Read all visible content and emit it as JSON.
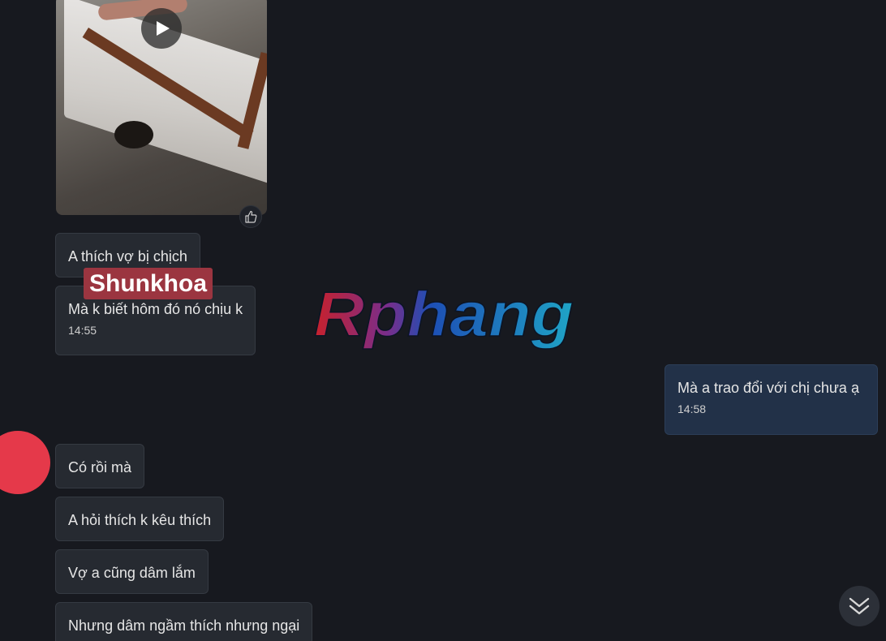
{
  "thread": {
    "video": {
      "icon": "play-icon",
      "reaction_icon": "thumbs-up-icon"
    },
    "messages": [
      {
        "text": "A thích vợ bị chịch",
        "time": ""
      },
      {
        "text": "Mà k biết hôm đó nó chịu k",
        "time": "14:55"
      },
      {
        "text": "Mà a trao đổi với chị chưa ạ",
        "time": "14:58",
        "outgoing": true
      },
      {
        "text": "Có rồi mà",
        "time": ""
      },
      {
        "text": "A hỏi thích k kêu thích",
        "time": ""
      },
      {
        "text": "Vợ a cũng dâm lắm",
        "time": ""
      },
      {
        "text": "Nhưng dâm ngầm thích nhưng ngại",
        "time": ""
      }
    ]
  },
  "overlays": {
    "name_tag": "Shunkhoa",
    "watermark": "Rphang"
  },
  "controls": {
    "scroll_down_icon": "double-chevron-down-icon"
  },
  "colors": {
    "background": "#17191f",
    "incoming_bubble": "#262a31",
    "outgoing_bubble": "#223148",
    "name_tag": "#9b3540",
    "avatar_dot": "#e5394a"
  }
}
